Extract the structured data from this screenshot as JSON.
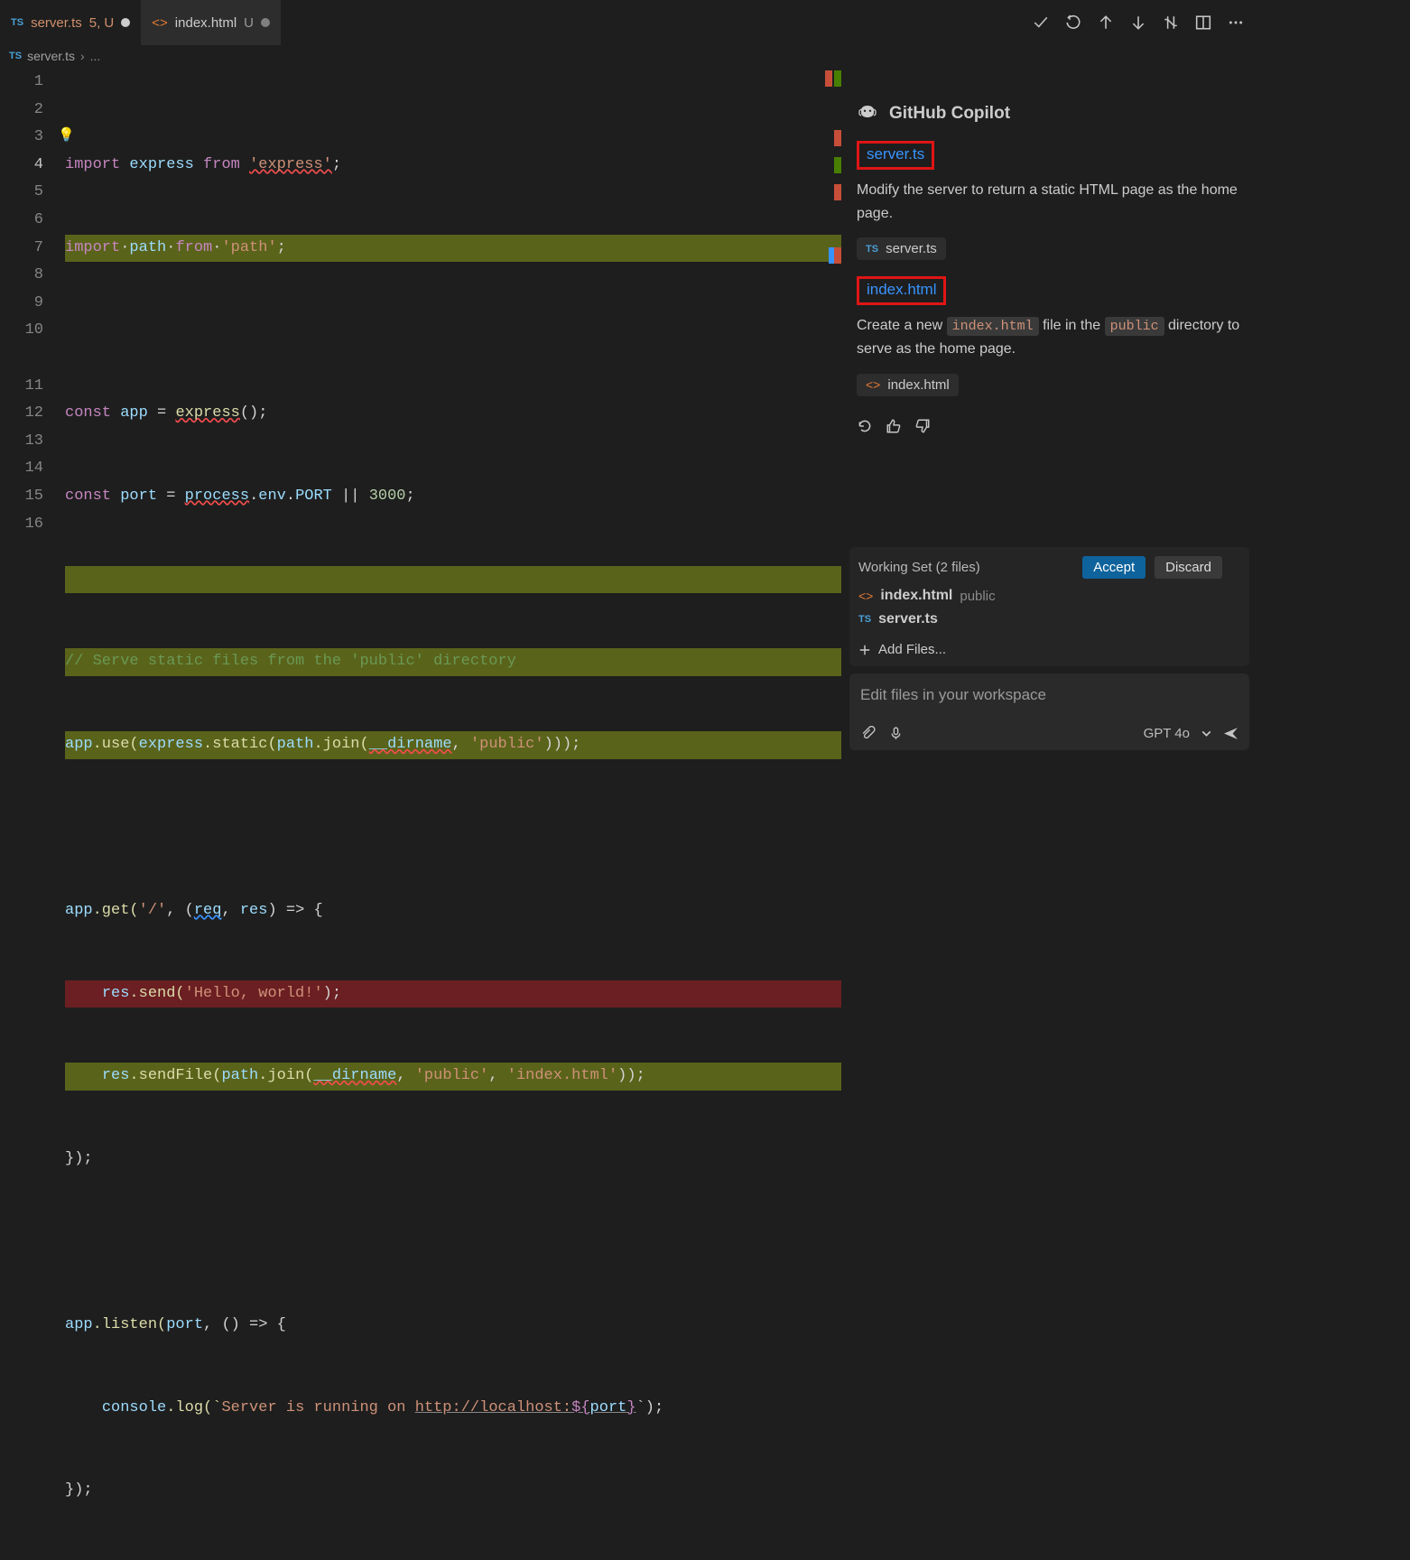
{
  "tabs": {
    "t1": {
      "icon": "TS",
      "name": "server.ts",
      "suffix": "5, U",
      "dirty": true
    },
    "t2": {
      "icon": "<>",
      "name": "index.html",
      "suffix": "U",
      "dirty": true
    }
  },
  "breadcrumb": {
    "icon": "TS",
    "file": "server.ts",
    "chev": "›",
    "rest": "..."
  },
  "code": {
    "lines": [
      "1",
      "2",
      "3",
      "4",
      "5",
      "6",
      "7",
      "8",
      "9",
      "10",
      "",
      "11",
      "12",
      "13",
      "14",
      "15",
      "16"
    ],
    "l1_import": "import",
    "l1_express_v": "express",
    "l1_from": "from",
    "l1_express_s": "'express'",
    "l1_semi": ";",
    "l2_import": "import",
    "l2_path": "path",
    "l2_from": "from",
    "l2_paths": "'path'",
    "l2_semi": ";",
    "l4_const": "const",
    "l4_app": "app",
    "l4_eq": " = ",
    "l4_express": "express",
    "l4_paren": "();",
    "l5_const": "const",
    "l5_port": "port",
    "l5_eq": " = ",
    "l5_process": "process",
    "l5_dot": ".",
    "l5_env": "env",
    "l5_dot2": ".",
    "l5_PORT": "PORT",
    "l5_or": " || ",
    "l5_3000": "3000",
    "l5_semi": ";",
    "l7_cmt": "// Serve static files from the 'public' directory",
    "l8_app": "app",
    "l8_use": ".use(",
    "l8_express": "express",
    "l8_static": ".static(",
    "l8_path": "path",
    "l8_join": ".join(",
    "l8_dirname": "__dirname",
    "l8_c": ", ",
    "l8_public": "'public'",
    "l8_end": ")));",
    "l10_app": "app",
    "l10_get": ".get(",
    "l10_root": "'/'",
    "l10_c": ", (",
    "l10_req": "req",
    "l10_cc": ", ",
    "l10_res": "res",
    "l10_arrow": ") => {",
    "l11a_res": "res",
    "l11a_send": ".send(",
    "l11a_hello": "'Hello, world!'",
    "l11a_end": ");",
    "l11b_res": "res",
    "l11b_sendFile": ".sendFile(",
    "l11b_path": "path",
    "l11b_join": ".join(",
    "l11b_dirname": "__dirname",
    "l11b_c": ", ",
    "l11b_public": "'public'",
    "l11b_c2": ", ",
    "l11b_index": "'index.html'",
    "l11b_end": "));",
    "l12": "});",
    "l14_app": "app",
    "l14_listen": ".listen(",
    "l14_port": "port",
    "l14_c": ", () => {",
    "l15_console": "console",
    "l15_log": ".log(`",
    "l15_txt": "Server is running on ",
    "l15_http": "http://localhost:",
    "l15_d": "${",
    "l15_port": "port",
    "l15_d2": "}",
    "l15_end": "`);",
    "l16": "});"
  },
  "copilot": {
    "title": "GitHub Copilot",
    "link1": "server.ts",
    "desc1": "Modify the server to return a static HTML page as the home page.",
    "chip1": "server.ts",
    "link2": "index.html",
    "desc2a": "Create a new ",
    "desc2_code1": "index.html",
    "desc2b": " file in the ",
    "desc2_code2": "public",
    "desc2c": " directory to serve as the home page.",
    "chip2": "index.html"
  },
  "workingSet": {
    "title": "Working Set (2 files)",
    "accept": "Accept",
    "discard": "Discard",
    "file1": {
      "name": "index.html",
      "sub": "public"
    },
    "file2": {
      "name": "server.ts"
    },
    "addFiles": "Add Files..."
  },
  "chat": {
    "placeholder": "Edit files in your workspace",
    "model": "GPT 4o"
  }
}
